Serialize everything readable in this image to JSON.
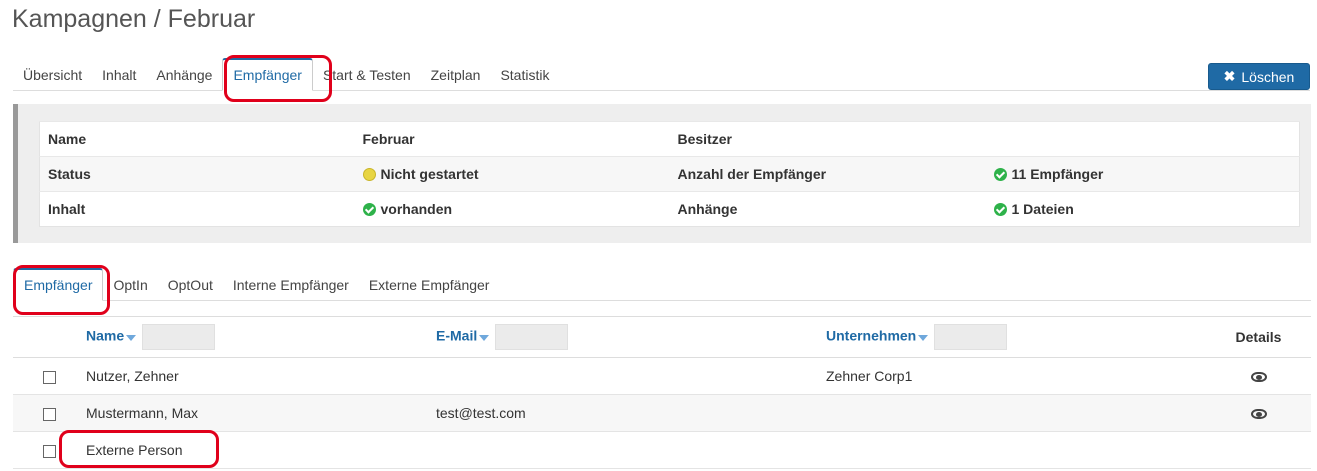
{
  "page": {
    "title": "Kampagnen / Februar"
  },
  "top_tabs": [
    {
      "label": "Übersicht",
      "active": false
    },
    {
      "label": "Inhalt",
      "active": false
    },
    {
      "label": "Anhänge",
      "active": false
    },
    {
      "label": "Empfänger",
      "active": true
    },
    {
      "label": "Start & Testen",
      "active": false
    },
    {
      "label": "Zeitplan",
      "active": false
    },
    {
      "label": "Statistik",
      "active": false
    }
  ],
  "delete_button": {
    "label": "Löschen",
    "icon": "times-icon"
  },
  "info": {
    "rows": [
      [
        "Name",
        "Februar",
        "Besitzer",
        ""
      ],
      [
        "Status",
        "Nicht gestartet",
        "Anzahl der Empfänger",
        "11 Empfänger"
      ],
      [
        "Inhalt",
        "vorhanden",
        "Anhänge",
        "1 Dateien"
      ]
    ],
    "status_icons": {
      "pending": "yellow-circle-icon",
      "ok": "green-check-circle-icon"
    }
  },
  "sub_tabs": [
    {
      "label": "Empfänger",
      "active": true
    },
    {
      "label": "OptIn",
      "active": false
    },
    {
      "label": "OptOut",
      "active": false
    },
    {
      "label": "Interne Empfänger",
      "active": false
    },
    {
      "label": "Externe Empfänger",
      "active": false
    }
  ],
  "grid": {
    "columns": {
      "name": "Name",
      "email": "E-Mail",
      "company": "Unternehmen",
      "details": "Details"
    },
    "rows": [
      {
        "name": "Nutzer, Zehner",
        "email": "",
        "company": "Zehner Corp1",
        "details": true
      },
      {
        "name": "Mustermann, Max",
        "email": "test@test.com",
        "company": "",
        "details": true
      },
      {
        "name": "Externe Person",
        "email": "",
        "company": "",
        "details": false
      }
    ]
  },
  "colors": {
    "accent": "#1f6aa5",
    "highlight": "#e0001b",
    "ok": "#2eb24a",
    "pending": "#e8d542"
  }
}
